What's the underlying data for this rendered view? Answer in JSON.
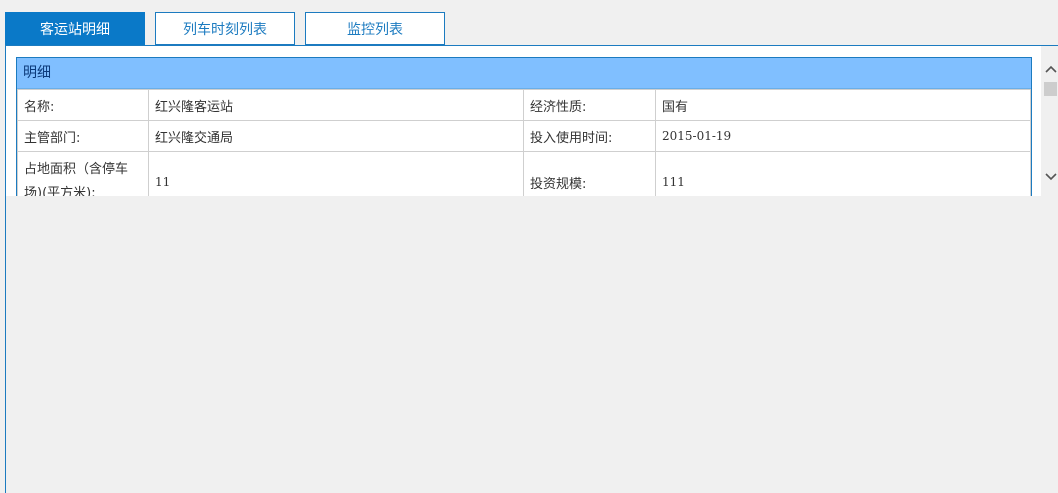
{
  "tabs": [
    {
      "label": "客运站明细",
      "active": true
    },
    {
      "label": "列车时刻列表",
      "active": false
    },
    {
      "label": "监控列表",
      "active": false
    }
  ],
  "detail": {
    "title": "明细",
    "rows": [
      {
        "label1": "名称:",
        "value1": "红兴隆客运站",
        "label2": "经济性质:",
        "value2": "国有"
      },
      {
        "label1": "主管部门:",
        "value1": "红兴隆交通局",
        "label2": "投入使用时间:",
        "value2": "2015-01-19"
      },
      {
        "label1": "占地面积（含停车场)(平方米):",
        "value1": "11",
        "label2": "投资规模:",
        "value2": "111"
      }
    ]
  },
  "colors": {
    "accent": "#1c7bc0",
    "tab_active": "#0a79c8",
    "header_bg": "#80bfff"
  },
  "icons": {
    "scroll_up": "chevron-up-icon",
    "scroll_down": "chevron-down-icon"
  }
}
